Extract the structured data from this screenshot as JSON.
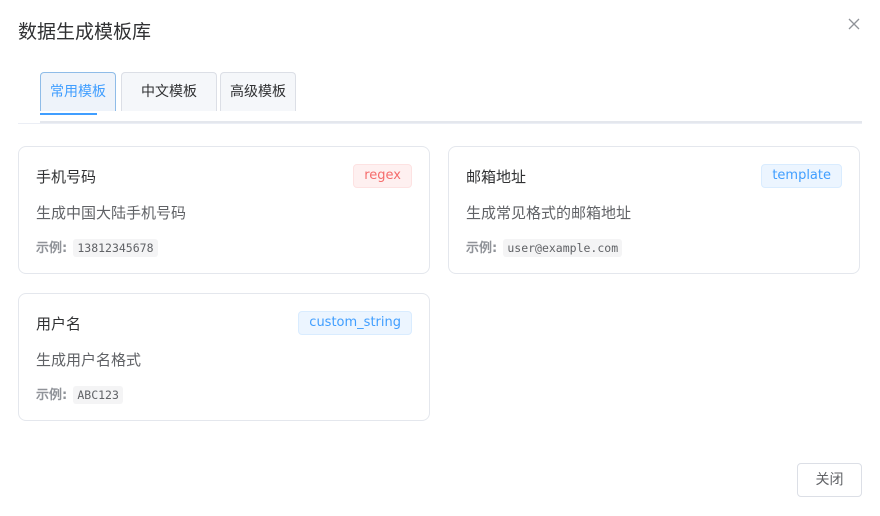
{
  "dialog": {
    "title": "数据生成模板库",
    "close_icon": "close-icon"
  },
  "tabs": [
    {
      "label": "常用模板",
      "active": true
    },
    {
      "label": "中文模板",
      "active": false
    },
    {
      "label": "高级模板",
      "active": false
    }
  ],
  "example_label": "示例:",
  "templates": [
    {
      "name": "手机号码",
      "tag": "regex",
      "tag_color": "#f56c6c",
      "description": "生成中国大陆手机号码",
      "example": "13812345678"
    },
    {
      "name": "邮箱地址",
      "tag": "template",
      "tag_color": "#409eff",
      "description": "生成常见格式的邮箱地址",
      "example": "user@example.com"
    },
    {
      "name": "用户名",
      "tag": "custom_string",
      "tag_color": "#409eff",
      "description": "生成用户名格式",
      "example": "ABC123"
    }
  ],
  "footer": {
    "close_label": "关闭"
  },
  "colors": {
    "primary": "#409eff",
    "danger": "#f56c6c",
    "border": "#e4e7ed"
  }
}
